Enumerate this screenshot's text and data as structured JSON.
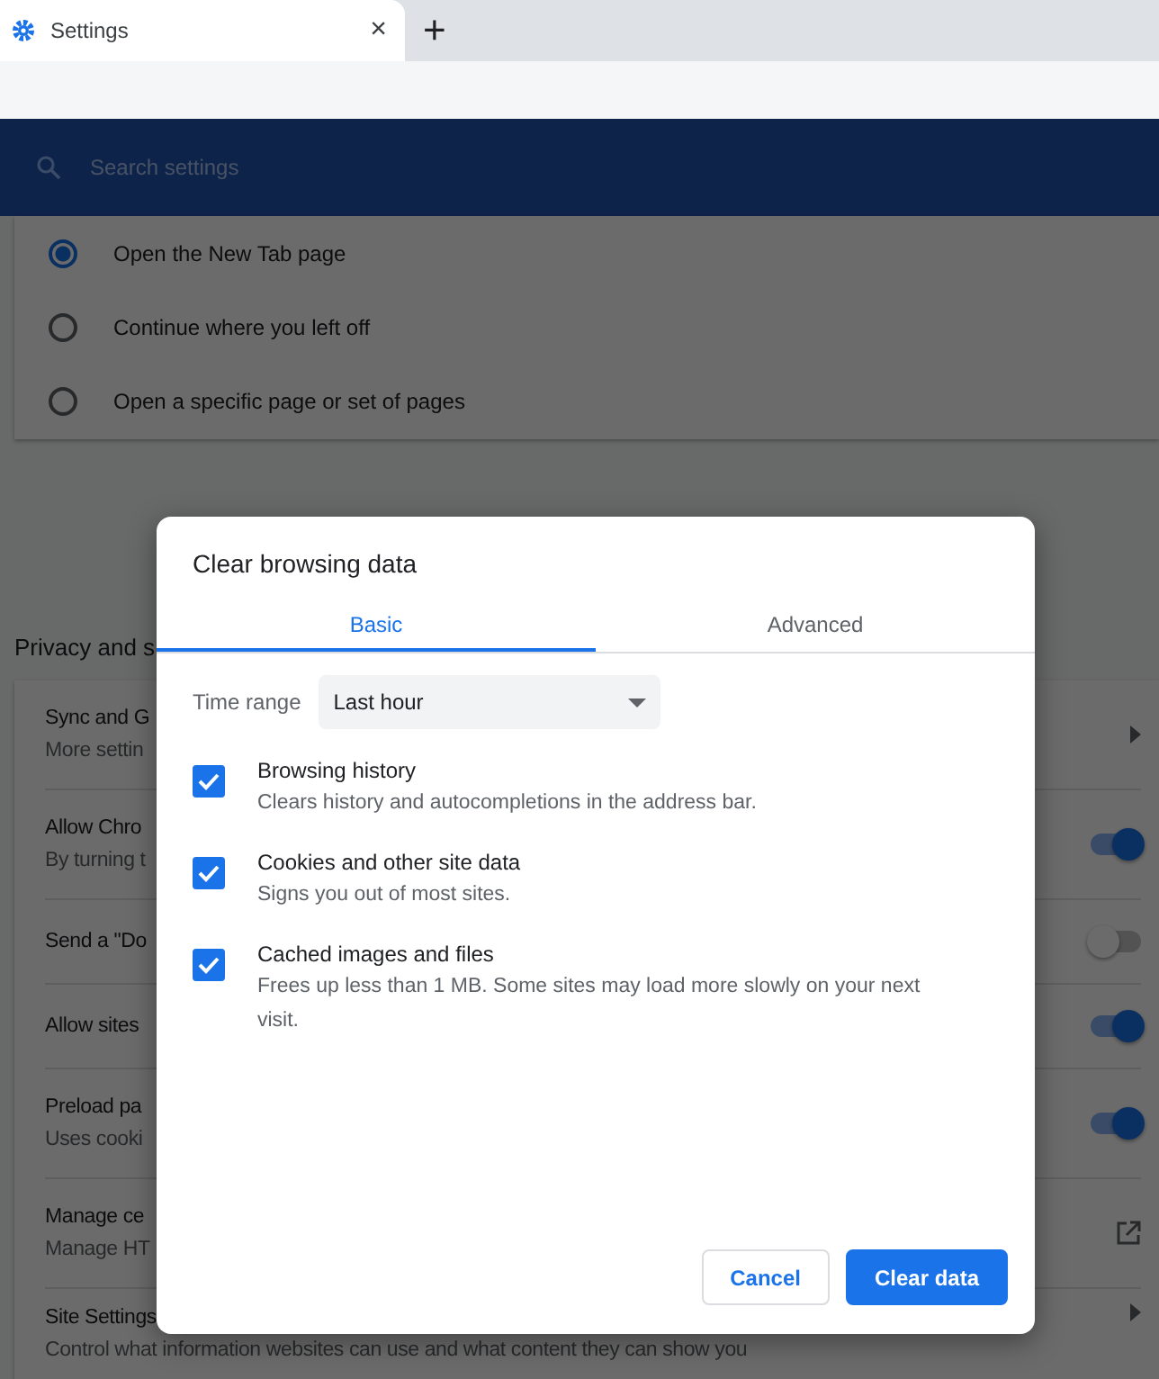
{
  "browser_tabs": [
    {
      "title": "Settings",
      "close": "×",
      "selected": true
    }
  ],
  "new_tab": "+",
  "search": {
    "placeholder": "Search settings"
  },
  "startup_options": [
    {
      "label": "Open the New Tab page",
      "selected": true
    },
    {
      "label": "Continue where you left off",
      "selected": false
    },
    {
      "label": "Open a specific page or set of pages",
      "selected": false
    }
  ],
  "privacy_title": "Privacy and s",
  "privacy_rows": [
    {
      "kind": "arrow",
      "title": "Sync and G",
      "subtitle": "More settin"
    },
    {
      "kind": "toggle",
      "title": "Allow Chro",
      "subtitle": "By turning t",
      "on": true
    },
    {
      "kind": "toggle",
      "title": "Send a \"Do",
      "on": false
    },
    {
      "kind": "toggle",
      "title": "Allow sites",
      "on": true
    },
    {
      "kind": "toggle",
      "title": "Preload pa",
      "subtitle": "Uses cooki",
      "on": true
    },
    {
      "kind": "external",
      "title": "Manage ce",
      "subtitle": "Manage HT"
    },
    {
      "kind": "arrow",
      "title": "Site Settings",
      "subtitle": "Control what information websites can use and what content they can show you"
    }
  ],
  "dialog": {
    "title": "Clear browsing data",
    "tabs": [
      {
        "label": "Basic",
        "selected": true
      },
      {
        "label": "Advanced",
        "selected": false
      }
    ],
    "time_range": {
      "label": "Time range",
      "value": "Last hour"
    },
    "items": [
      {
        "title": "Browsing history",
        "description": "Clears history and autocompletions in the address bar.",
        "checked": true
      },
      {
        "title": "Cookies and other site data",
        "description": "Signs you out of most sites.",
        "checked": true
      },
      {
        "title": "Cached images and files",
        "description": "Frees up less than 1 MB. Some sites may load more slowly on your next visit.",
        "checked": true
      }
    ],
    "buttons": [
      {
        "label": "Cancel",
        "kind": "secondary"
      },
      {
        "label": "Clear data",
        "kind": "primary"
      }
    ]
  }
}
